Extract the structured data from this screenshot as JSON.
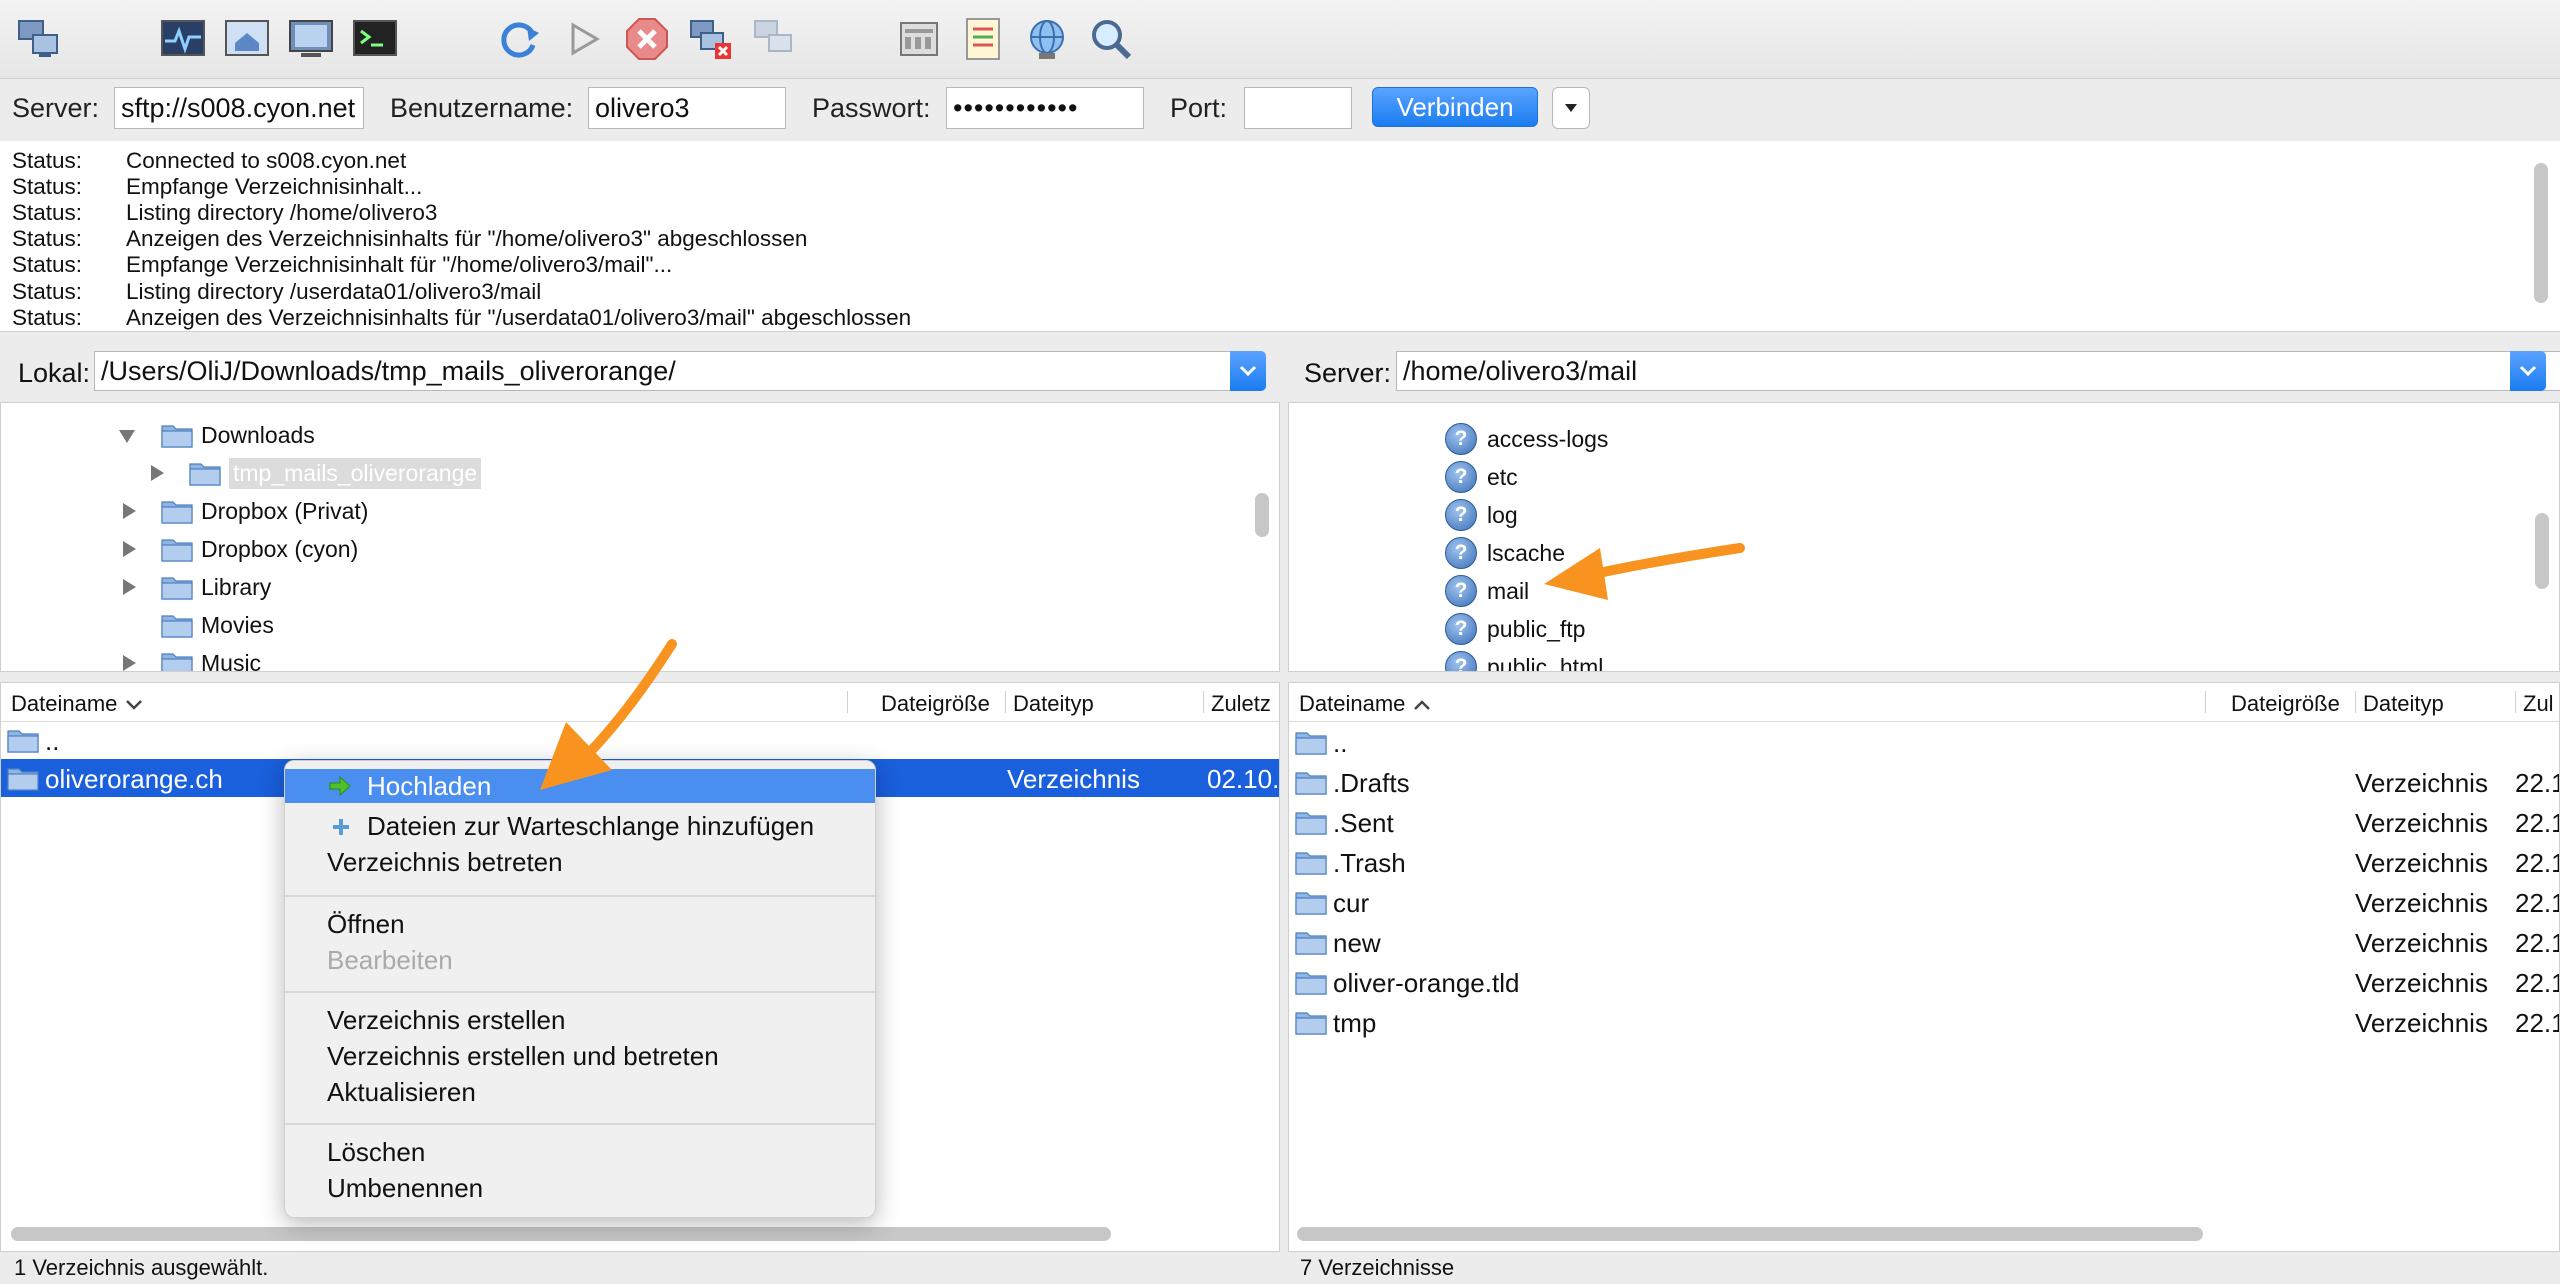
{
  "toolbar": {
    "icons": [
      "site-manager-icon",
      "message-log-icon",
      "local-tree-icon",
      "remote-tree-icon",
      "transfer-queue-icon",
      "refresh-icon",
      "process-queue-icon",
      "cancel-icon",
      "disconnect-icon",
      "reconnect-icon",
      "directory-listing-filters-icon",
      "compare-icon",
      "sync-browse-icon",
      "search-icon"
    ]
  },
  "quickconnect": {
    "server_label": "Server:",
    "server_value": "sftp://s008.cyon.net",
    "user_label": "Benutzername:",
    "user_value": "olivero3",
    "pass_label": "Passwort:",
    "pass_value": "••••••••••••",
    "port_label": "Port:",
    "port_value": "",
    "connect_label": "Verbinden"
  },
  "log": {
    "rows": [
      {
        "k": "Status:",
        "v": "Connected to s008.cyon.net"
      },
      {
        "k": "Status:",
        "v": "Empfange Verzeichnisinhalt..."
      },
      {
        "k": "Status:",
        "v": "Listing directory /home/olivero3"
      },
      {
        "k": "Status:",
        "v": "Anzeigen des Verzeichnisinhalts für \"/home/olivero3\" abgeschlossen"
      },
      {
        "k": "Status:",
        "v": "Empfange Verzeichnisinhalt für \"/home/olivero3/mail\"..."
      },
      {
        "k": "Status:",
        "v": "Listing directory /userdata01/olivero3/mail"
      },
      {
        "k": "Status:",
        "v": "Anzeigen des Verzeichnisinhalts für \"/userdata01/olivero3/mail\" abgeschlossen"
      }
    ]
  },
  "local": {
    "label": "Lokal:",
    "path": "/Users/OliJ/Downloads/tmp_mails_oliverorange/",
    "tree": [
      "Downloads",
      "tmp_mails_oliverorange",
      "Dropbox (Privat)",
      "Dropbox (cyon)",
      "Library",
      "Movies",
      "Music"
    ],
    "headers": {
      "name": "Dateiname",
      "size": "Dateigröße",
      "type": "Dateityp",
      "modified": "Zuletz"
    },
    "files": [
      {
        "name": "..",
        "type": "",
        "modified": ""
      },
      {
        "name": "oliverorange.ch",
        "type": "Verzeichnis",
        "modified": "02.10."
      }
    ],
    "status": "1 Verzeichnis ausgewählt."
  },
  "remote": {
    "label": "Server:",
    "path": "/home/olivero3/mail",
    "tree": [
      "access-logs",
      "etc",
      "log",
      "lscache",
      "mail",
      "public_ftp",
      "public_html"
    ],
    "headers": {
      "name": "Dateiname",
      "size": "Dateigröße",
      "type": "Dateityp",
      "modified": "Zul"
    },
    "files": [
      {
        "name": "..",
        "type": "",
        "modified": ""
      },
      {
        "name": ".Drafts",
        "type": "Verzeichnis",
        "modified": "22.1"
      },
      {
        "name": ".Sent",
        "type": "Verzeichnis",
        "modified": "22.1"
      },
      {
        "name": ".Trash",
        "type": "Verzeichnis",
        "modified": "22.1"
      },
      {
        "name": "cur",
        "type": "Verzeichnis",
        "modified": "22.1"
      },
      {
        "name": "new",
        "type": "Verzeichnis",
        "modified": "22.1"
      },
      {
        "name": "oliver-orange.tld",
        "type": "Verzeichnis",
        "modified": "22.1"
      },
      {
        "name": "tmp",
        "type": "Verzeichnis",
        "modified": "22.1"
      }
    ],
    "status": "7 Verzeichnisse"
  },
  "context_menu": {
    "items": [
      {
        "label": "Hochladen",
        "icon": "upload-arrow-icon"
      },
      {
        "label": "Dateien zur Warteschlange hinzufügen",
        "icon": "plus-icon"
      },
      {
        "label": "Verzeichnis betreten"
      },
      {
        "label": "Öffnen"
      },
      {
        "label": "Bearbeiten"
      },
      {
        "label": "Verzeichnis erstellen"
      },
      {
        "label": "Verzeichnis erstellen und betreten"
      },
      {
        "label": "Aktualisieren"
      },
      {
        "label": "Löschen"
      },
      {
        "label": "Umbenennen"
      }
    ]
  },
  "colors": {
    "accent": "#1b7cf0",
    "selection": "#1a5fdc",
    "annotation_arrow": "#f7931e"
  }
}
